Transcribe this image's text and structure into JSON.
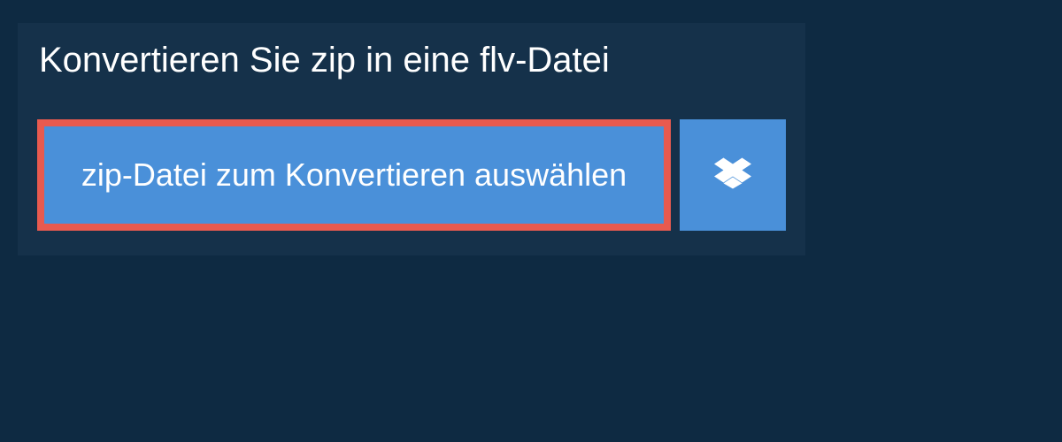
{
  "header": {
    "title": "Konvertieren Sie zip in eine flv-Datei"
  },
  "actions": {
    "select_file_label": "zip-Datei zum Konvertieren auswählen",
    "dropbox_label": "Dropbox"
  }
}
